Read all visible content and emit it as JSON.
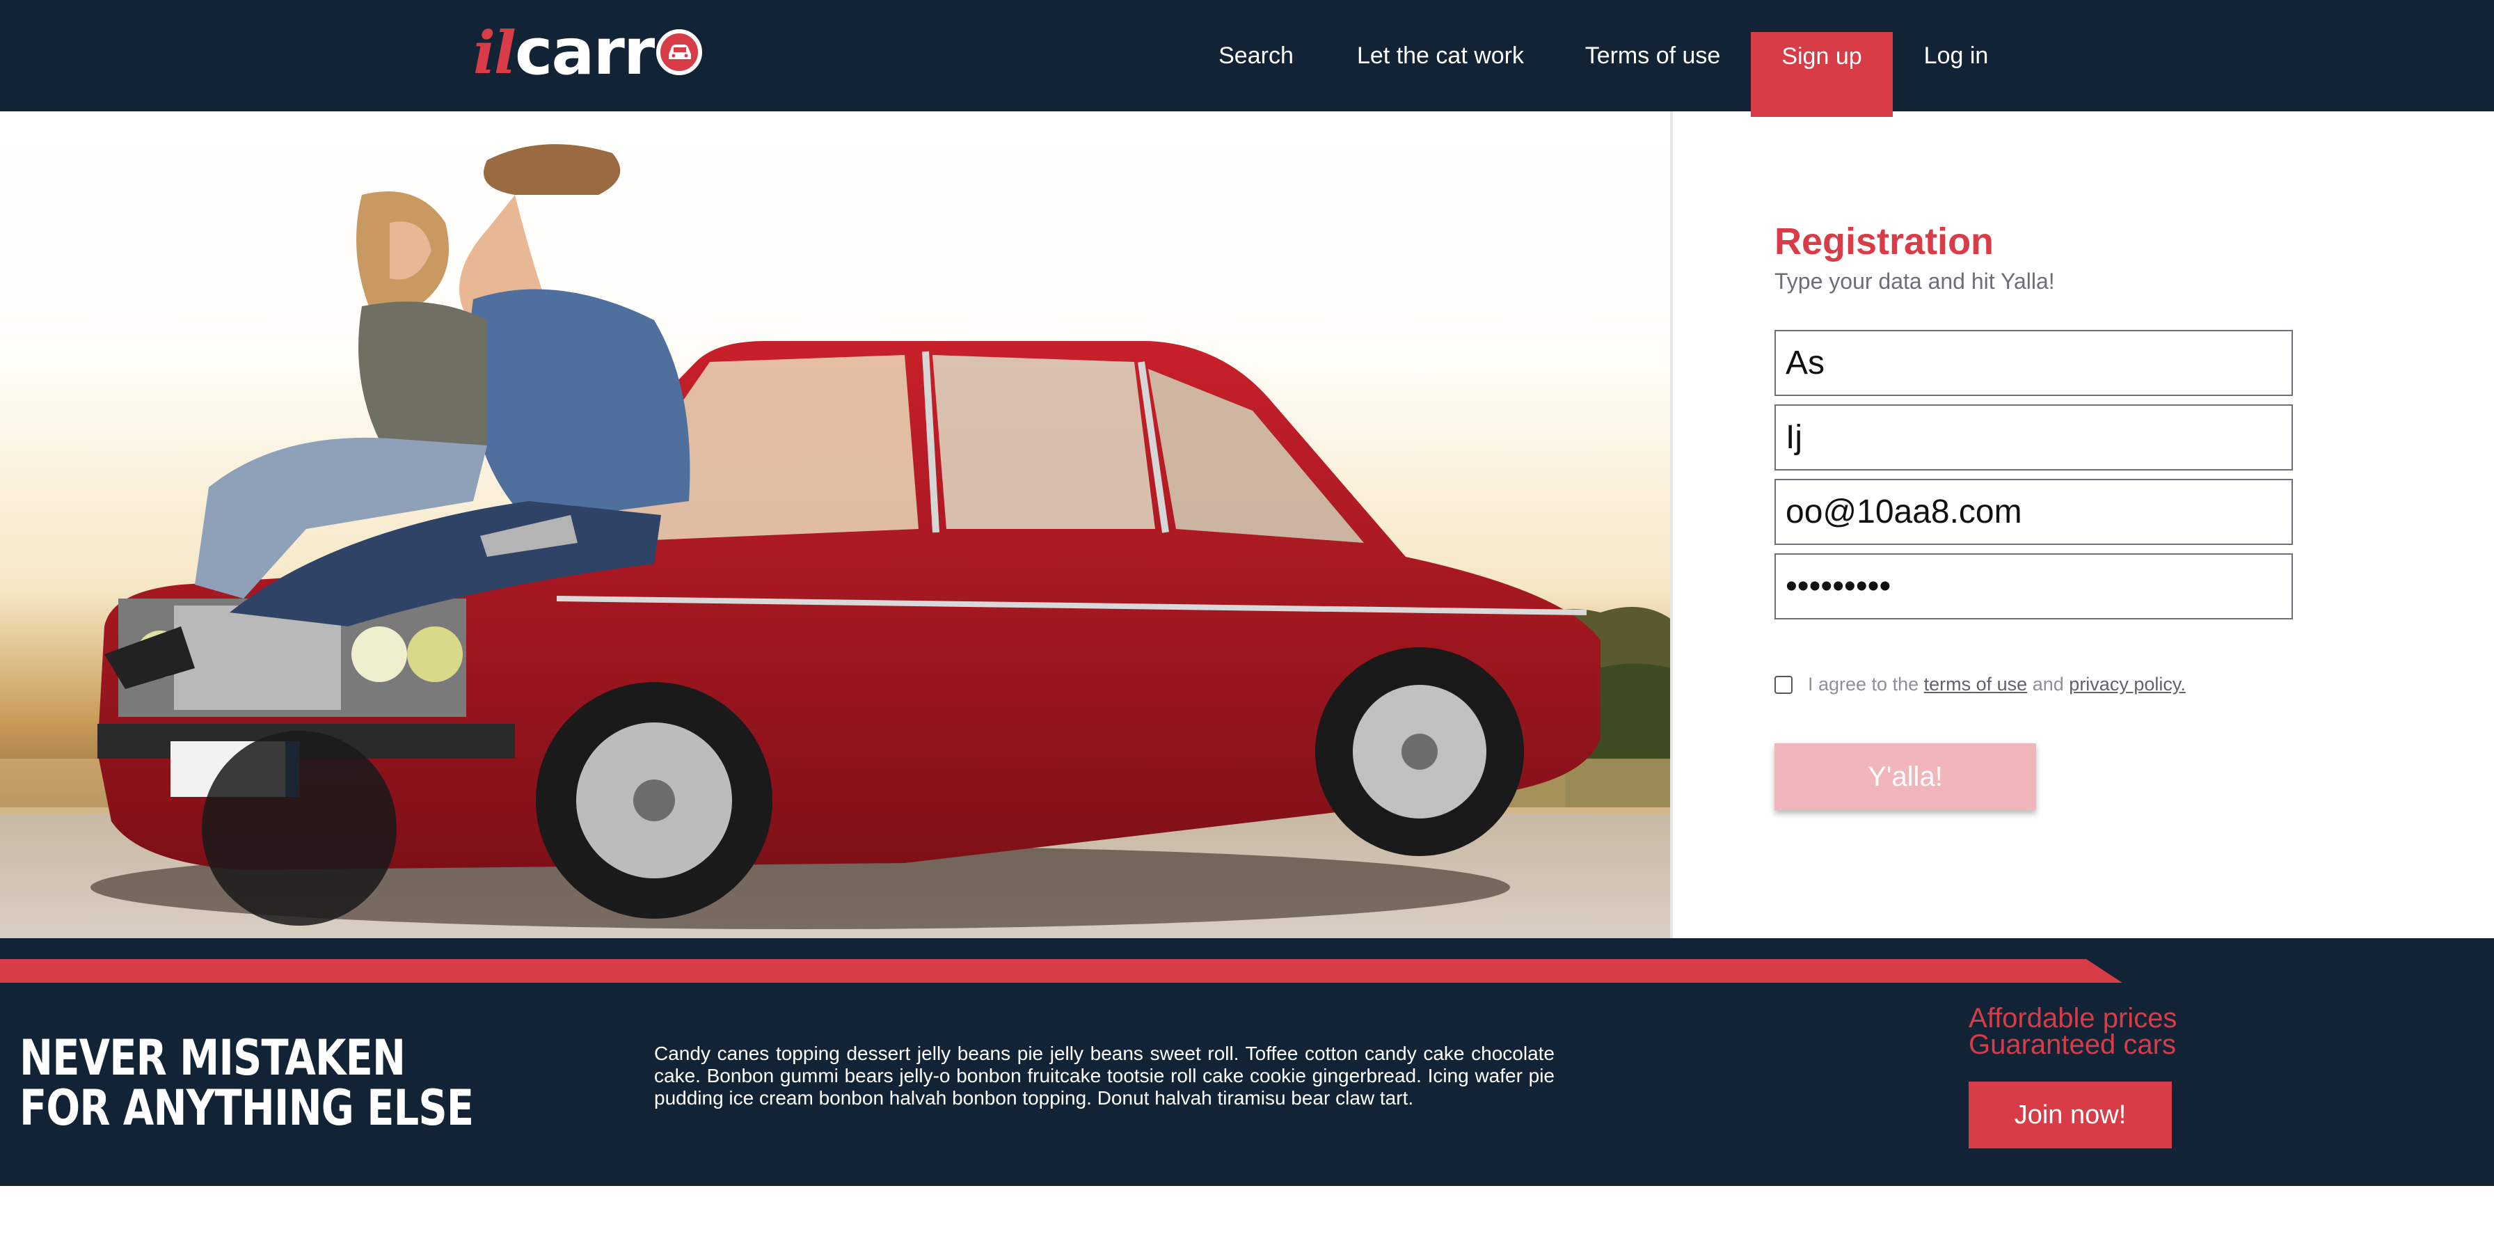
{
  "brand": {
    "logo_il": "il",
    "logo_carr": "carr",
    "accent_color": "#d73c47",
    "dark_color": "#122335"
  },
  "nav": {
    "items": [
      {
        "label": "Search"
      },
      {
        "label": "Let the cat work"
      },
      {
        "label": "Terms of use"
      },
      {
        "label": "Sign up"
      },
      {
        "label": "Log in"
      }
    ],
    "active": "Sign up"
  },
  "registration": {
    "title": "Registration",
    "subtitle": "Type your data and hit Yalla!",
    "fields": {
      "first_name": "As",
      "last_name": "Ij",
      "email": "oo@10aa8.com",
      "password": "•••••••••"
    },
    "agree_prefix": "I agree to the",
    "terms_link": "terms of use",
    "agree_and": "and",
    "privacy_link": "privacy policy.",
    "agree_checked": false,
    "submit_label": "Y'alla!"
  },
  "footer": {
    "slogan_line1": "NEVER MISTAKEN",
    "slogan_line2": "FOR ANYTHING ELSE",
    "description": "Candy canes topping dessert jelly beans pie jelly beans sweet roll. Toffee cotton candy cake chocolate cake. Bonbon gummi bears jelly-o bonbon fruitcake tootsie roll cake cookie gingerbread. Icing wafer pie pudding ice cream bonbon halvah bonbon topping. Donut halvah tiramisu bear claw tart.",
    "promo_line1": "Affordable prices",
    "promo_line2": "Guaranteed cars",
    "join_label": "Join now!"
  }
}
